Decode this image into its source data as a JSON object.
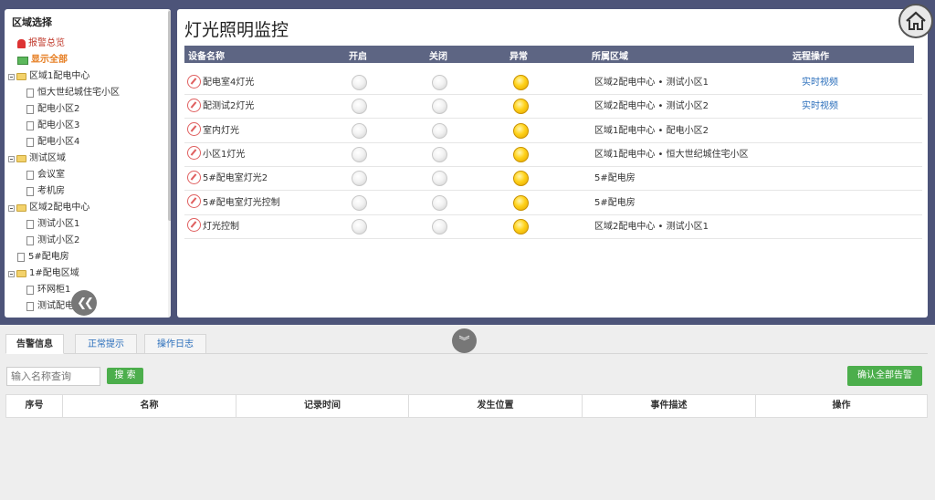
{
  "left": {
    "title": "区域选择",
    "tree": [
      {
        "label": "报警总览",
        "kind": "alarm"
      },
      {
        "label": "显示全部",
        "kind": "map"
      },
      {
        "label": "区域1配电中心",
        "kind": "folder"
      },
      {
        "label": "恒大世纪城住宅小区",
        "kind": "doc"
      },
      {
        "label": "配电小区2",
        "kind": "doc"
      },
      {
        "label": "配电小区3",
        "kind": "doc"
      },
      {
        "label": "配电小区4",
        "kind": "doc"
      },
      {
        "label": "测试区域",
        "kind": "folder"
      },
      {
        "label": "会议室",
        "kind": "doc"
      },
      {
        "label": "考机房",
        "kind": "doc"
      },
      {
        "label": "区域2配电中心",
        "kind": "folder"
      },
      {
        "label": "测试小区1",
        "kind": "doc"
      },
      {
        "label": "测试小区2",
        "kind": "doc"
      },
      {
        "label": "5#配电房",
        "kind": "doc"
      },
      {
        "label": "1#配电区域",
        "kind": "folder"
      },
      {
        "label": "环网柜1",
        "kind": "doc"
      },
      {
        "label": "测试配电",
        "kind": "doc"
      }
    ]
  },
  "main": {
    "title": "灯光照明监控",
    "columns": [
      "设备名称",
      "开启",
      "关闭",
      "异常",
      "所属区域",
      "远程操作"
    ],
    "rows": [
      {
        "name": "配电室4灯光",
        "on": false,
        "off": false,
        "abnormal": true,
        "area": "区域2配电中心 • 测试小区1",
        "action": "实时视频"
      },
      {
        "name": "配测试2灯光",
        "on": false,
        "off": false,
        "abnormal": true,
        "area": "区域2配电中心 • 测试小区2",
        "action": "实时视频"
      },
      {
        "name": "室内灯光",
        "on": false,
        "off": false,
        "abnormal": true,
        "area": "区域1配电中心 • 配电小区2",
        "action": ""
      },
      {
        "name": "小区1灯光",
        "on": false,
        "off": false,
        "abnormal": true,
        "area": "区域1配电中心 • 恒大世纪城住宅小区",
        "action": ""
      },
      {
        "name": "5#配电室灯光2",
        "on": false,
        "off": false,
        "abnormal": true,
        "area": "5#配电房",
        "action": ""
      },
      {
        "name": "5#配电室灯光控制",
        "on": false,
        "off": false,
        "abnormal": true,
        "area": "5#配电房",
        "action": ""
      },
      {
        "name": "灯光控制",
        "on": false,
        "off": false,
        "abnormal": true,
        "area": "区域2配电中心 • 测试小区1",
        "action": ""
      }
    ]
  },
  "bottom": {
    "tabs": [
      "告警信息",
      "正常提示",
      "操作日志"
    ],
    "active_tab": "告警信息",
    "search_placeholder": "输入名称查询",
    "search_label": "搜 索",
    "confirm_label": "确认全部告警",
    "columns": [
      "序号",
      "名称",
      "记录时间",
      "发生位置",
      "事件描述",
      "操作"
    ]
  },
  "icons": {
    "home": "home-icon",
    "collapse_left": "double-chevron-left-icon",
    "collapse_down": "double-chevron-down-icon"
  },
  "colors": {
    "frame": "#4d5479",
    "grid_header": "#5d6583",
    "lamp_abnormal": "#ffd21a",
    "button_green": "#4cae4c",
    "link": "#2a6ebb"
  }
}
